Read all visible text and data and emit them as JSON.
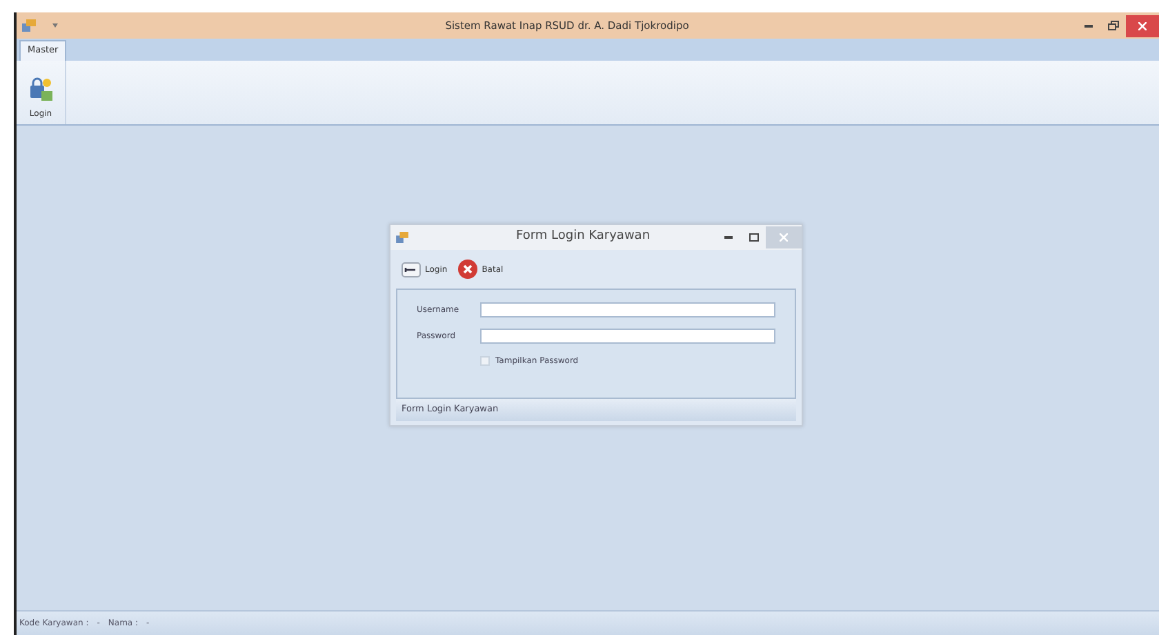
{
  "window": {
    "title": "Sistem Rawat Inap RSUD dr. A. Dadi Tjokrodipo"
  },
  "ribbon_tabs": [
    {
      "label": "Master",
      "selected": true
    }
  ],
  "ribbon_buttons": [
    {
      "label": "Login"
    }
  ],
  "dialog": {
    "title": "Form Login Karyawan",
    "toolbar": [
      {
        "label": "Login",
        "kind": "key"
      },
      {
        "label": "Batal",
        "kind": "cancel"
      }
    ],
    "fields": [
      {
        "label": "Username"
      },
      {
        "label": "Password"
      }
    ],
    "checkbox": {
      "label": "Tampilkan Password",
      "checked": false
    },
    "status": "Form Login Karyawan"
  },
  "status_bar": [
    "Kode Karyawan :",
    "-",
    "Nama :",
    "-"
  ]
}
